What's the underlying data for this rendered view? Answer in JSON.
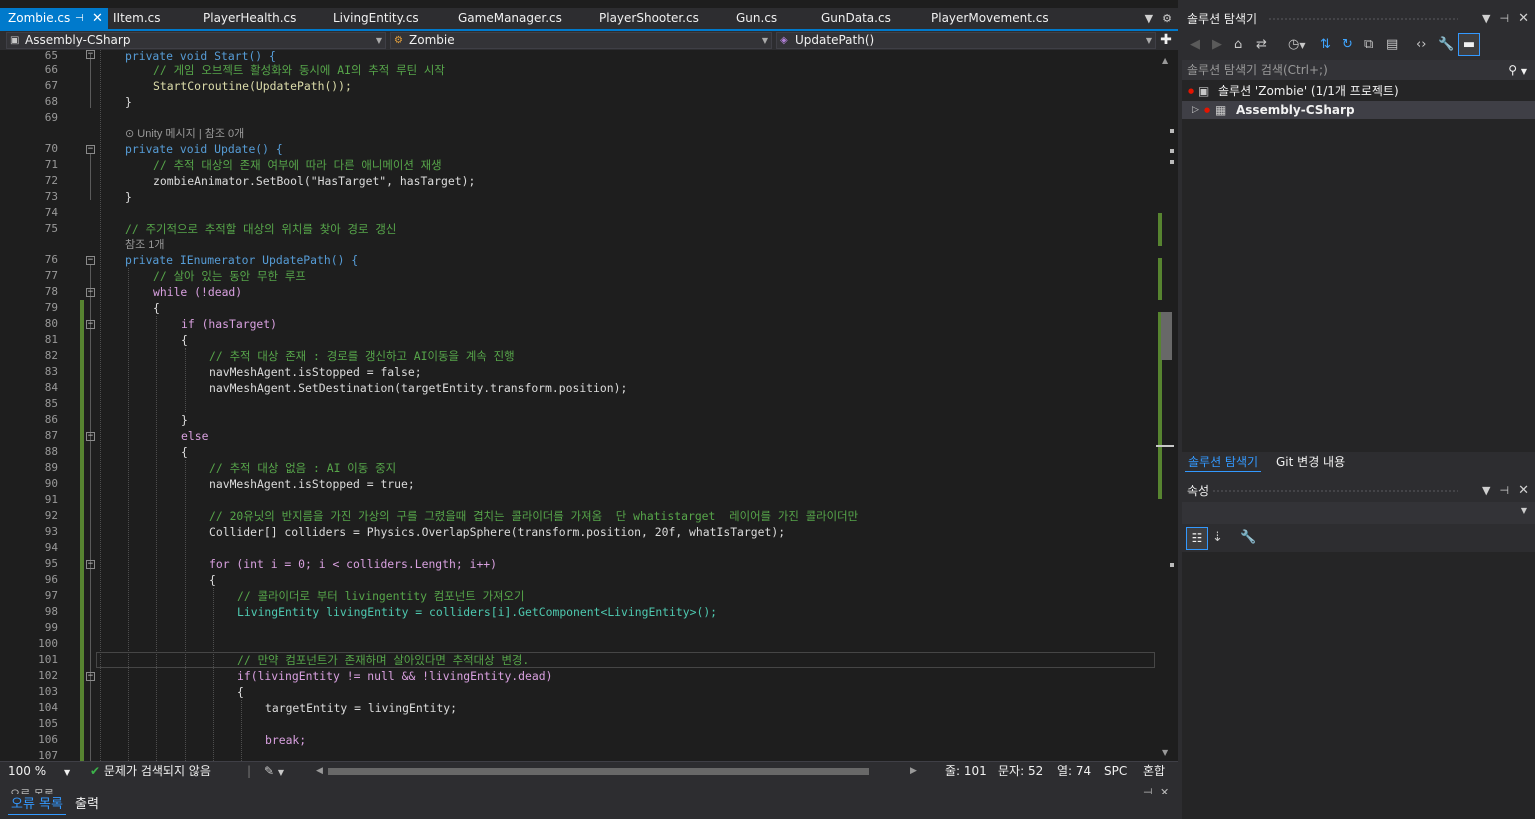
{
  "tabs": [
    {
      "label": "Zombie.cs",
      "active": true
    },
    {
      "label": "IItem.cs"
    },
    {
      "label": "PlayerHealth.cs"
    },
    {
      "label": "LivingEntity.cs"
    },
    {
      "label": "GameManager.cs"
    },
    {
      "label": "PlayerShooter.cs"
    },
    {
      "label": "Gun.cs"
    },
    {
      "label": "GunData.cs"
    },
    {
      "label": "PlayerMovement.cs"
    }
  ],
  "nav": {
    "project": "Assembly-CSharp",
    "class_name": "Zombie",
    "member": "UpdatePath()"
  },
  "codelens": {
    "unity_msg": "Unity 메시지 | 참조 0개",
    "ref1": "참조 1개"
  },
  "code_lines": {
    "65": "private void Start() {",
    "66": "// 게임 오브젝트 활성화와 동시에 AI의 추적 루틴 시작",
    "67": "StartCoroutine(UpdatePath());",
    "68": "}",
    "69": "",
    "70": "private void Update() {",
    "71": "// 추적 대상의 존재 여부에 따라 다른 애니메이션 재생",
    "72": "zombieAnimator.SetBool(\"HasTarget\", hasTarget);",
    "73": "}",
    "74": "",
    "75": "// 주기적으로 추적할 대상의 위치를 찾아 경로 갱신",
    "76": "private IEnumerator UpdatePath() {",
    "77": "// 살아 있는 동안 무한 루프",
    "78": "while (!dead)",
    "79": "{",
    "80": "if (hasTarget)",
    "81": "{",
    "82": "// 추적 대상 존재 : 경로를 갱신하고 AI이동을 계속 진행",
    "83": "navMeshAgent.isStopped = false;",
    "84": "navMeshAgent.SetDestination(targetEntity.transform.position);",
    "85": "",
    "86": "}",
    "87": "else",
    "88": "{",
    "89": "// 추적 대상 없음 : AI 이동 중지",
    "90": "navMeshAgent.isStopped = true;",
    "91": "",
    "92": "// 20유닛의 반지름을 가진 가상의 구를 그렸을때 겹치는 콜라이더를 가져옴  단 whatistarget  레이어를 가진 콜라이더만",
    "93": "Collider[] colliders = Physics.OverlapSphere(transform.position, 20f, whatIsTarget);",
    "94": "",
    "95": "for (int i = 0; i < colliders.Length; i++)",
    "96": "{",
    "97": "// 콜라이더로 부터 livingentity 컴포넌트 가져오기",
    "98": "LivingEntity livingEntity = colliders[i].GetComponent<LivingEntity>();",
    "99": "",
    "100": "",
    "101": "// 만약 컴포넌트가 존재하며 살아있다면 추적대상 변경.",
    "102": "if(livingEntity != null && !livingEntity.dead)",
    "103": "{",
    "104": "targetEntity = livingEntity;",
    "105": "",
    "106": "break;",
    "107": ""
  },
  "status": {
    "zoom": "100 %",
    "issues": "문제가 검색되지 않음",
    "line": "줄: 101",
    "char": "문자: 52",
    "col": "열: 74",
    "spc": "SPC",
    "eol": "혼합"
  },
  "bottom_tabs": [
    "오류 목록",
    "출력"
  ],
  "bottom_header_text": "오류 목록",
  "solution_explorer": {
    "title": "솔루션 탐색기",
    "search_placeholder": "솔루션 탐색기 검색(Ctrl+;)",
    "solution_label": "솔루션 'Zombie' (1/1개 프로젝트)",
    "project_label": "Assembly-CSharp",
    "tabs": [
      "솔루션 탐색기",
      "Git 변경 내용"
    ]
  },
  "properties": {
    "title": "속성"
  },
  "colors": {
    "accent": "#007acc",
    "keyword": "#569cd6",
    "comment": "#57a64a",
    "type": "#4ec9b0",
    "string": "#d69d85",
    "change_margin": "#578430",
    "error_dot": "#e51400"
  },
  "icons": [
    "pin-icon",
    "close-icon",
    "dropdown-icon",
    "gear-icon",
    "split-icon",
    "search-icon",
    "home-icon",
    "refresh-icon",
    "wrench-icon",
    "check-circle-icon",
    "brush-icon",
    "solution-icon",
    "project-icon"
  ]
}
